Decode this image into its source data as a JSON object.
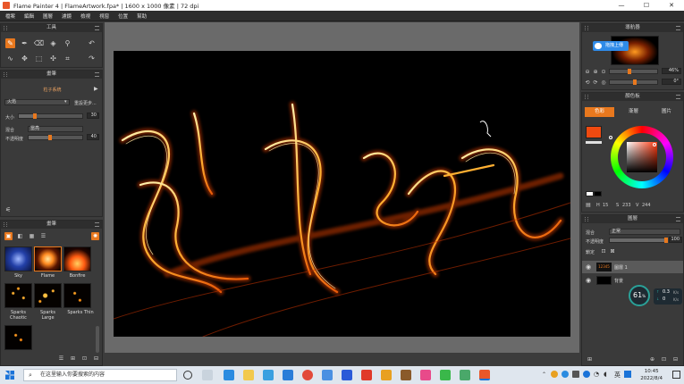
{
  "window": {
    "title": "Flame Painter 4 | FlameArtwork.fpa* | 1600 x 1000 像素 | 72 dpi",
    "minimize": "—",
    "maximize": "☐",
    "close": "✕"
  },
  "menu": [
    "檔案",
    "編輯",
    "圖層",
    "濾鏡",
    "檢視",
    "視窗",
    "位置",
    "幫助"
  ],
  "tools_panel": {
    "title": "工具"
  },
  "brush_panel": {
    "title": "畫筆",
    "system_label": "粒子系統",
    "preset_value": "火焰",
    "reset_label": "重設更步...",
    "size_label": "大小",
    "size_value": "30",
    "size_level": 0.25,
    "blend_label": "混合",
    "blend_value": "當亮",
    "opacity_label": "不透明度",
    "opacity_value": "40",
    "opacity_level": 0.4
  },
  "presets_panel": {
    "title": "畫筆",
    "items": [
      {
        "label": "Sky"
      },
      {
        "label": "Flame"
      },
      {
        "label": "Bonfire"
      },
      {
        "label": "Sparks\nChaotic"
      },
      {
        "label": "Sparks\nLarge"
      },
      {
        "label": "Sparks Thin"
      }
    ]
  },
  "navigator": {
    "title": "導航器",
    "upload_label": "拖拽上傳",
    "zoom_value": "46%",
    "rotate_value": "0°"
  },
  "colors": {
    "title": "顏色板",
    "tabs": [
      "色彩",
      "漸層",
      "圖片"
    ],
    "h": "15",
    "s": "233",
    "v": "244",
    "current_color": "#f04a10",
    "accent": "#e8781e"
  },
  "layers": {
    "title": "圖層",
    "blend_label": "混合",
    "blend_value": "正常",
    "opacity_label": "不透明度",
    "opacity_value": "100",
    "lock_label": "鎖定",
    "items": [
      {
        "name": "圖層 1",
        "thumb_label": "12345"
      },
      {
        "name": "背景"
      }
    ],
    "gauge_value": "61",
    "gauge_unit": "%",
    "up_rate": "0.3",
    "up_unit": "K/s",
    "down_rate": "0",
    "down_unit": "K/s"
  },
  "taskbar": {
    "search_placeholder": "在这里输入你要搜索的内容",
    "time": "10:45",
    "date": "2022/8/4",
    "ime": "英"
  }
}
